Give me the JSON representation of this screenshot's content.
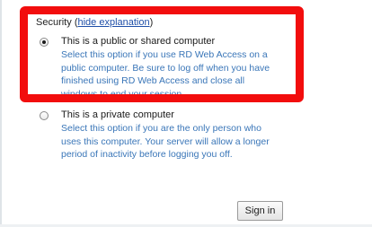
{
  "security": {
    "label": "Security",
    "open_paren": "(",
    "link": "hide explanation",
    "close_paren": ")"
  },
  "options": [
    {
      "label": "This is a public or shared computer",
      "selected": true,
      "description_lines": [
        "Select this option if you use RD Web Access on a",
        "public computer. Be sure to log off when you have",
        "finished using RD Web Access and close all",
        "windows to end your session."
      ]
    },
    {
      "label": "This is a private computer",
      "selected": false,
      "description_lines": [
        "Select this option if you are the only person who",
        "uses this computer. Your server will allow a longer",
        "period of inactivity before logging you off."
      ]
    }
  ],
  "sign_in_label": "Sign in",
  "colors": {
    "highlight": "#f20d0d",
    "link": "#1f4fa8",
    "description": "#3a76b8"
  }
}
